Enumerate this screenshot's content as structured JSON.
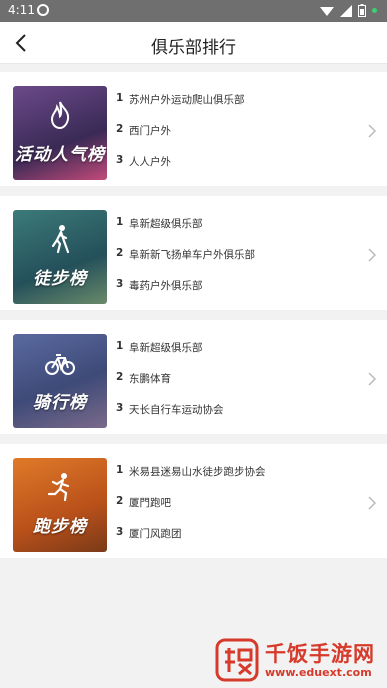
{
  "status_bar": {
    "time": "4:11"
  },
  "header": {
    "title": "俱乐部排行"
  },
  "boards": [
    {
      "title": "活动人气榜",
      "icon": "flame-icon",
      "color": "#4a3a6e",
      "items": [
        {
          "rank": "1",
          "name": "苏州户外运动爬山俱乐部"
        },
        {
          "rank": "2",
          "name": "西门户外"
        },
        {
          "rank": "3",
          "name": "人人户外"
        }
      ]
    },
    {
      "title": "徒步榜",
      "icon": "hiker-icon",
      "color": "#2f5f6a",
      "items": [
        {
          "rank": "1",
          "name": "阜新超级俱乐部"
        },
        {
          "rank": "2",
          "name": "阜新新飞扬单车户外俱乐部"
        },
        {
          "rank": "3",
          "name": "毒药户外俱乐部"
        }
      ]
    },
    {
      "title": "骑行榜",
      "icon": "bicycle-icon",
      "color": "#4a5a8a",
      "items": [
        {
          "rank": "1",
          "name": "阜新超级俱乐部"
        },
        {
          "rank": "2",
          "name": "东鹏体育"
        },
        {
          "rank": "3",
          "name": "天长自行车运动协会"
        }
      ]
    },
    {
      "title": "跑步榜",
      "icon": "runner-icon",
      "color": "#c8621e",
      "items": [
        {
          "rank": "1",
          "name": "米易县迷易山水徒步跑步协会"
        },
        {
          "rank": "2",
          "name": "厦門跑吧"
        },
        {
          "rank": "3",
          "name": "厦门风跑团"
        }
      ]
    }
  ],
  "watermark": {
    "title": "千饭手游网",
    "url": "www.eduext.com"
  }
}
